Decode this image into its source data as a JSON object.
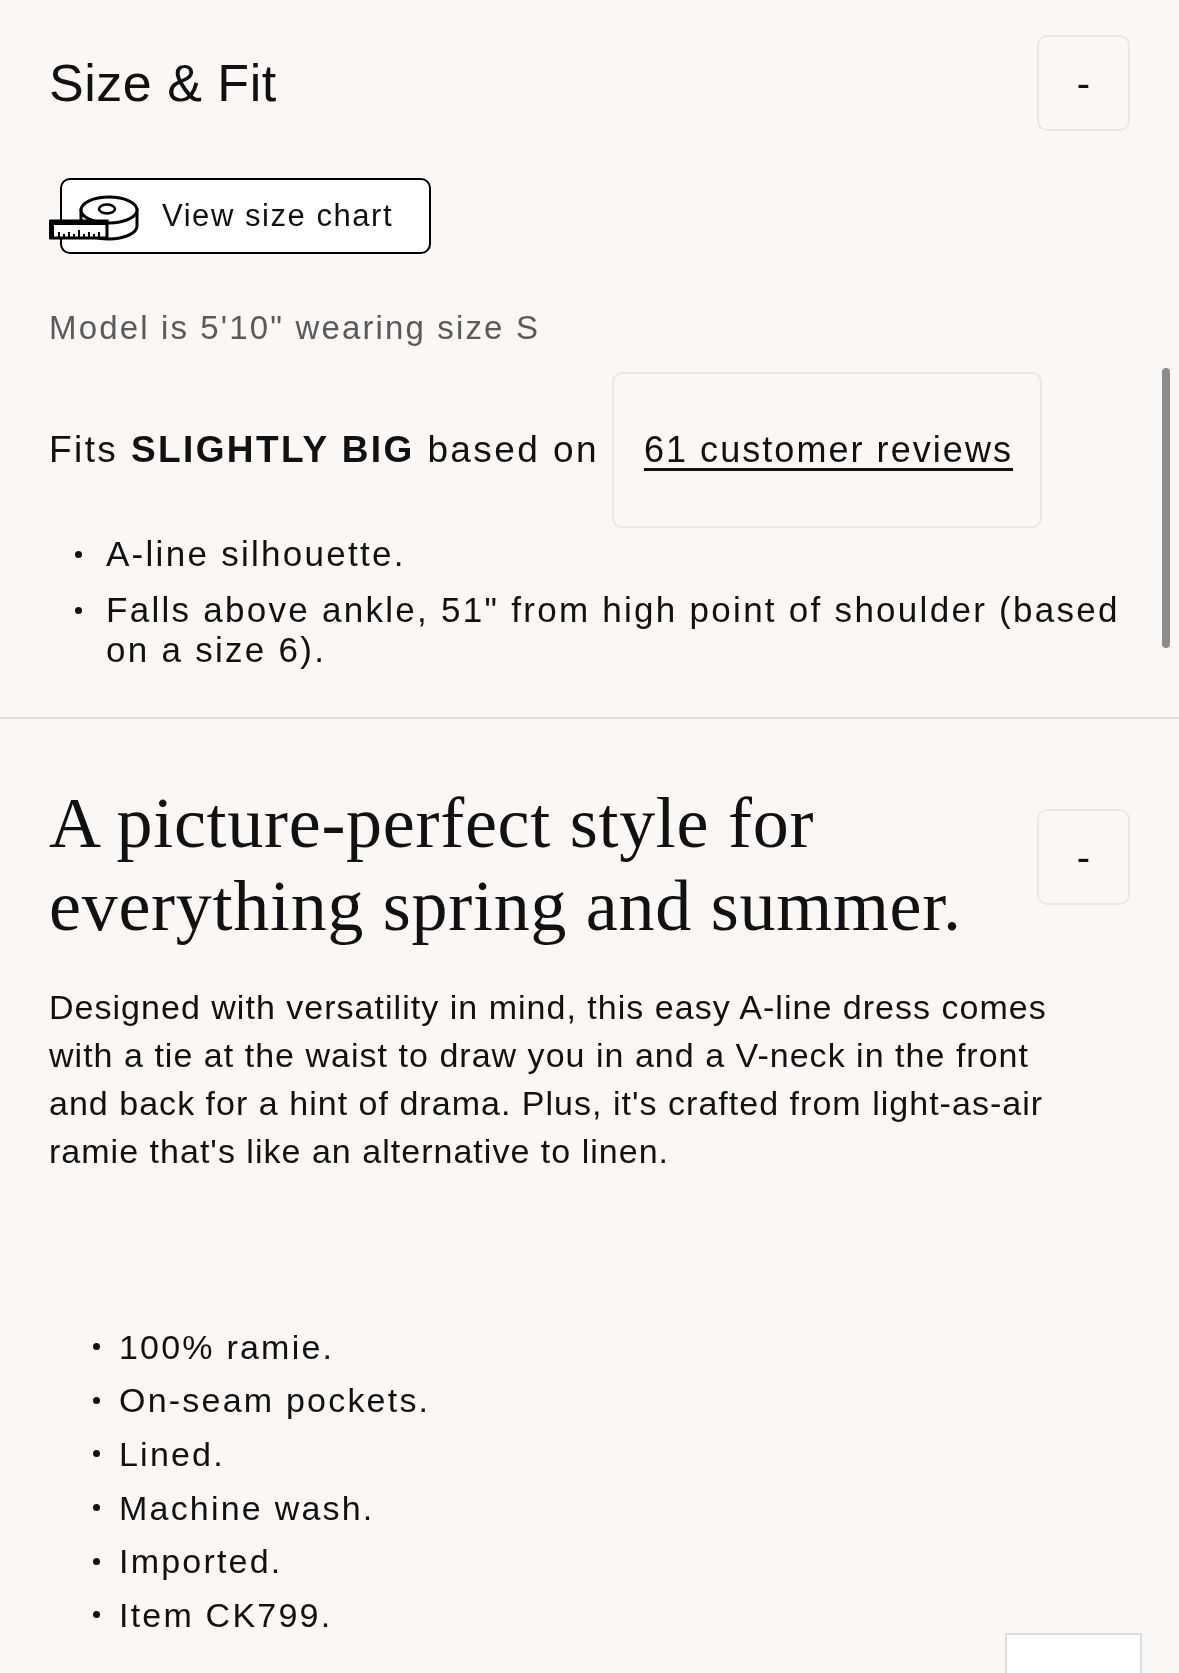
{
  "size_fit": {
    "title": "Size & Fit",
    "toggle_label": "-",
    "size_chart_button": {
      "label": "View size chart"
    },
    "model_note": "Model is 5'10\" wearing size S",
    "fit": {
      "summary": "Fits **SLIGHTLY BIG** based on",
      "reviews_link": "61 customer reviews"
    },
    "details": [
      "A-line silhouette.",
      "Falls above ankle, 51\" from high point of shoulder (based on a size 6)."
    ]
  },
  "description": {
    "title": "A picture-perfect style for everything spring and summer.",
    "toggle_label": "-",
    "body": "Designed with versatility in mind, this easy A-line dress comes with a tie at the waist to draw you in and a V-neck in the front and back for a hint of drama. Plus, it's crafted from light-as-air ramie that's like an alternative to linen.",
    "features": [
      "100% ramie.",
      "On-seam pockets.",
      "Lined.",
      "Machine wash.",
      "Imported.",
      "Item CK799."
    ]
  }
}
